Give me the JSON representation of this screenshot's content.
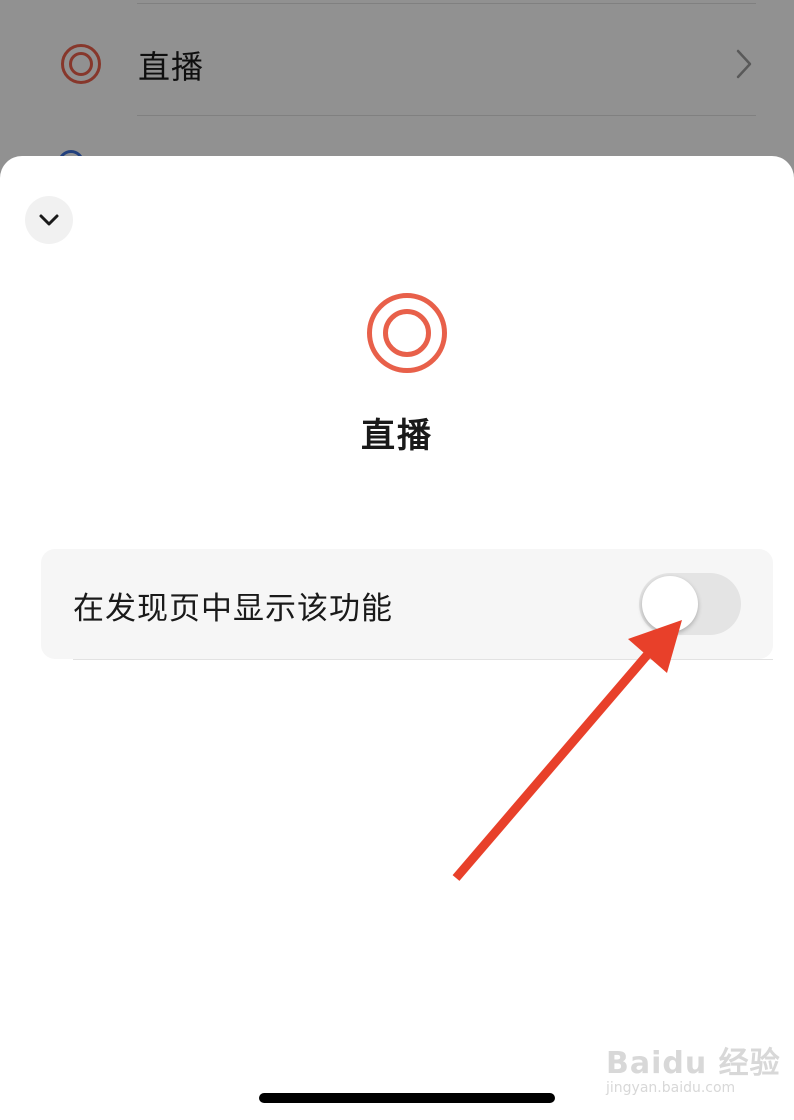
{
  "background_list": {
    "item_live": {
      "label": "直播",
      "icon": "live-ring-icon",
      "chevron": "chevron-right-icon"
    },
    "peek_icon": "circle-icon"
  },
  "sheet": {
    "collapse_icon": "chevron-down-icon",
    "feature_icon": "live-ring-icon",
    "title": "直播",
    "setting": {
      "label": "在发现页中显示该功能",
      "toggle_on": false
    }
  },
  "annotation": {
    "type": "arrow",
    "color": "#e8402a"
  },
  "watermark": {
    "main": "Baidu 经验",
    "sub": "jingyan.baidu.com"
  },
  "colors": {
    "accent": "#e8604a",
    "toggle_off": "#e4e4e4",
    "overlay": "rgba(0,0,0,0.42)"
  }
}
